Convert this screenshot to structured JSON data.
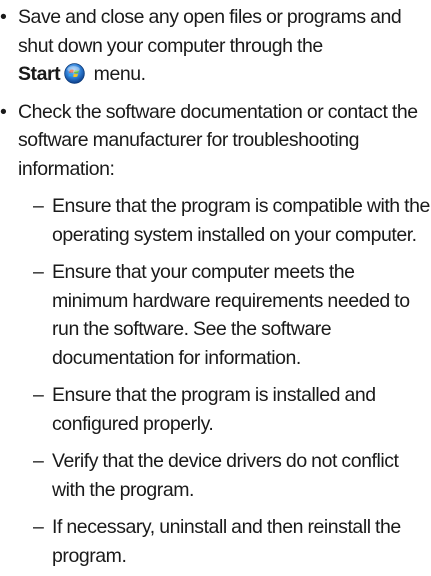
{
  "bullets": [
    {
      "mark": "•",
      "text_before": "Save and close any open files or programs and shut down your computer through the",
      "bold_word": "Start",
      "icon": "windows-start-orb-icon",
      "text_after": "menu."
    },
    {
      "mark": "•",
      "text": "Check the software documentation or contact the software manufacturer for troubleshooting information:"
    }
  ],
  "subitems": [
    {
      "mark": "–",
      "text": "Ensure that the program is compatible with the operating system installed on your computer."
    },
    {
      "mark": "–",
      "text": "Ensure that your computer meets the minimum hardware requirements needed to run the software. See the software documentation for information."
    },
    {
      "mark": "–",
      "text": "Ensure that the program is installed and configured properly."
    },
    {
      "mark": "–",
      "text": "Verify that the device drivers do not conflict with the program."
    },
    {
      "mark": "–",
      "text": "If necessary, uninstall and then reinstall the program."
    }
  ],
  "colors": {
    "text": "#1a1a1a",
    "orb_blue": "#2f7fd6",
    "orb_red": "#e84a2a",
    "orb_green": "#6cc23a",
    "orb_yellow": "#f7c61f"
  }
}
